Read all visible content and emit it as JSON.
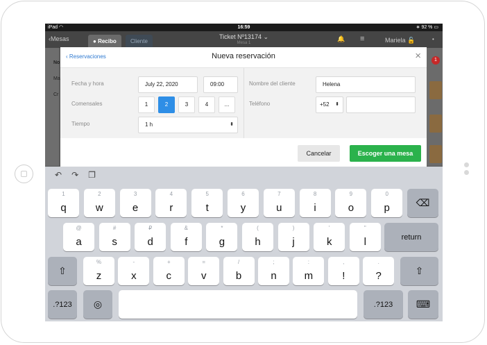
{
  "status": {
    "device": "iPad",
    "wifi_icon": "wifi-icon",
    "time": "16:59",
    "battery": "92 %"
  },
  "appbar": {
    "back_label": "Mesas",
    "tab_receipt": "Recibo",
    "tab_client": "Cliente",
    "ticket": "Ticket Nº13174",
    "ticket_sub": "Mesa 1",
    "user": "Mariela",
    "icons": [
      "bell-icon",
      "menu-icon",
      "lock-icon"
    ]
  },
  "background": {
    "side_items": [
      "No",
      "Ma",
      "Cr"
    ],
    "right_badge": "1"
  },
  "modal": {
    "back_link": "Reservaciones",
    "title": "Nueva reservación",
    "labels": {
      "date_time": "Fecha y hora",
      "guests": "Comensales",
      "time": "Tiempo",
      "client_name": "Nombre del cliente",
      "phone": "Teléfono"
    },
    "date": "July 22, 2020",
    "hour": "09:00",
    "guest_options": [
      "1",
      "2",
      "3",
      "4",
      "..."
    ],
    "guest_selected": "2",
    "duration": "1 h",
    "client_name": "Helena",
    "phone_prefix": "+52",
    "phone_value": "",
    "cancel_label": "Cancelar",
    "submit_label": "Escoger una mesa"
  },
  "keyboard": {
    "row1": [
      {
        "k": "q",
        "h": "1"
      },
      {
        "k": "w",
        "h": "2"
      },
      {
        "k": "e",
        "h": "3"
      },
      {
        "k": "r",
        "h": "4"
      },
      {
        "k": "t",
        "h": "5"
      },
      {
        "k": "y",
        "h": "6"
      },
      {
        "k": "u",
        "h": "7"
      },
      {
        "k": "i",
        "h": "8"
      },
      {
        "k": "o",
        "h": "9"
      },
      {
        "k": "p",
        "h": "0"
      }
    ],
    "row2": [
      {
        "k": "a",
        "h": "@"
      },
      {
        "k": "s",
        "h": "#"
      },
      {
        "k": "d",
        "h": "₽"
      },
      {
        "k": "f",
        "h": "&"
      },
      {
        "k": "g",
        "h": "*"
      },
      {
        "k": "h",
        "h": "("
      },
      {
        "k": "j",
        "h": ")"
      },
      {
        "k": "k",
        "h": "'"
      },
      {
        "k": "l",
        "h": "\""
      }
    ],
    "row3": [
      {
        "k": "z",
        "h": "%"
      },
      {
        "k": "x",
        "h": "-"
      },
      {
        "k": "c",
        "h": "+"
      },
      {
        "k": "v",
        "h": "="
      },
      {
        "k": "b",
        "h": "/"
      },
      {
        "k": "n",
        "h": ";"
      },
      {
        "k": "m",
        "h": ":"
      },
      {
        "k": "!",
        "h": ","
      },
      {
        "k": "?",
        "h": "."
      }
    ],
    "return_label": "return",
    "numbers_label": ".?123",
    "icons": [
      "undo-icon",
      "redo-icon",
      "paste-icon",
      "backspace-icon",
      "shift-icon",
      "globe-icon",
      "hide-keyboard-icon"
    ]
  }
}
